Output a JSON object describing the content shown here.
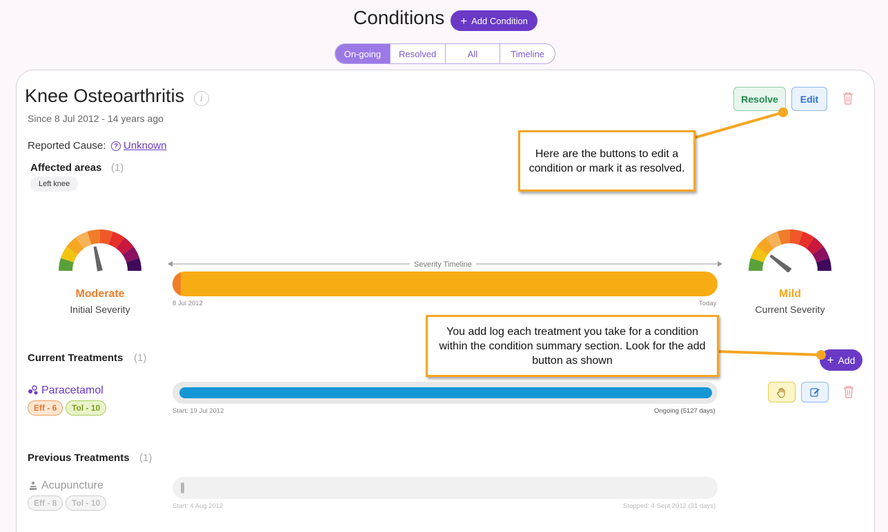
{
  "header": {
    "title": "Conditions",
    "add_condition_label": "Add Condition",
    "tabs": [
      {
        "label": "On-going",
        "active": true
      },
      {
        "label": "Resolved",
        "active": false
      },
      {
        "label": "All",
        "active": false
      },
      {
        "label": "Timeline",
        "active": false
      }
    ]
  },
  "condition": {
    "name": "Knee Osteoarthritis",
    "since": "Since 8 Jul 2012 - 14 years ago",
    "reported_cause_label": "Reported Cause:",
    "reported_cause_value": "Unknown",
    "affected_areas_title": "Affected areas",
    "affected_areas_count": "(1)",
    "affected_areas": [
      "Left knee"
    ],
    "actions": {
      "resolve": "Resolve",
      "edit": "Edit"
    },
    "initial_severity": {
      "level": "Moderate",
      "label": "Initial Severity",
      "color": "#ef7d2a"
    },
    "current_severity": {
      "level": "Mild",
      "label": "Current Severity",
      "color": "#f5a623"
    },
    "severity_timeline": {
      "label": "Severity Timeline",
      "start": "8 Jul 2012",
      "end": "Today",
      "colors": {
        "initial": "#ef7d2a",
        "current": "#f8ac14"
      }
    }
  },
  "current_treatments": {
    "title": "Current Treatments",
    "count": "(1)",
    "add_label": "Add",
    "items": [
      {
        "name": "Paracetamol",
        "eff": "Eff - 6",
        "tol": "Tol - 10",
        "start": "Start: 19 Jul 2012",
        "status": "Ongoing (5127 days)",
        "bar_color": "#1597d6"
      }
    ]
  },
  "previous_treatments": {
    "title": "Previous Treatments",
    "count": "(1)",
    "items": [
      {
        "name": "Acupuncture",
        "eff": "Eff - 8",
        "tol": "Tol - 10",
        "start": "Start: 4 Aug 2012",
        "status": "Stopped: 4 Sept 2012 (31 days)"
      }
    ]
  },
  "callouts": {
    "edit_resolve": "Here are the buttons to edit a condition or mark it as resolved.",
    "add_treatment": "You add log each treatment you take for a condition within the condition summary section. Look for the add button as shown"
  },
  "icons": [
    "plus-icon",
    "info-icon",
    "question-icon",
    "trash-icon",
    "pill-icon",
    "acupuncture-icon",
    "hand-icon",
    "pencil-icon",
    "gauge-needle-icon"
  ],
  "colors": {
    "accent": "#6a3ac7",
    "tab_active": "#9b7ae6",
    "callout_border": "#f5a623"
  }
}
